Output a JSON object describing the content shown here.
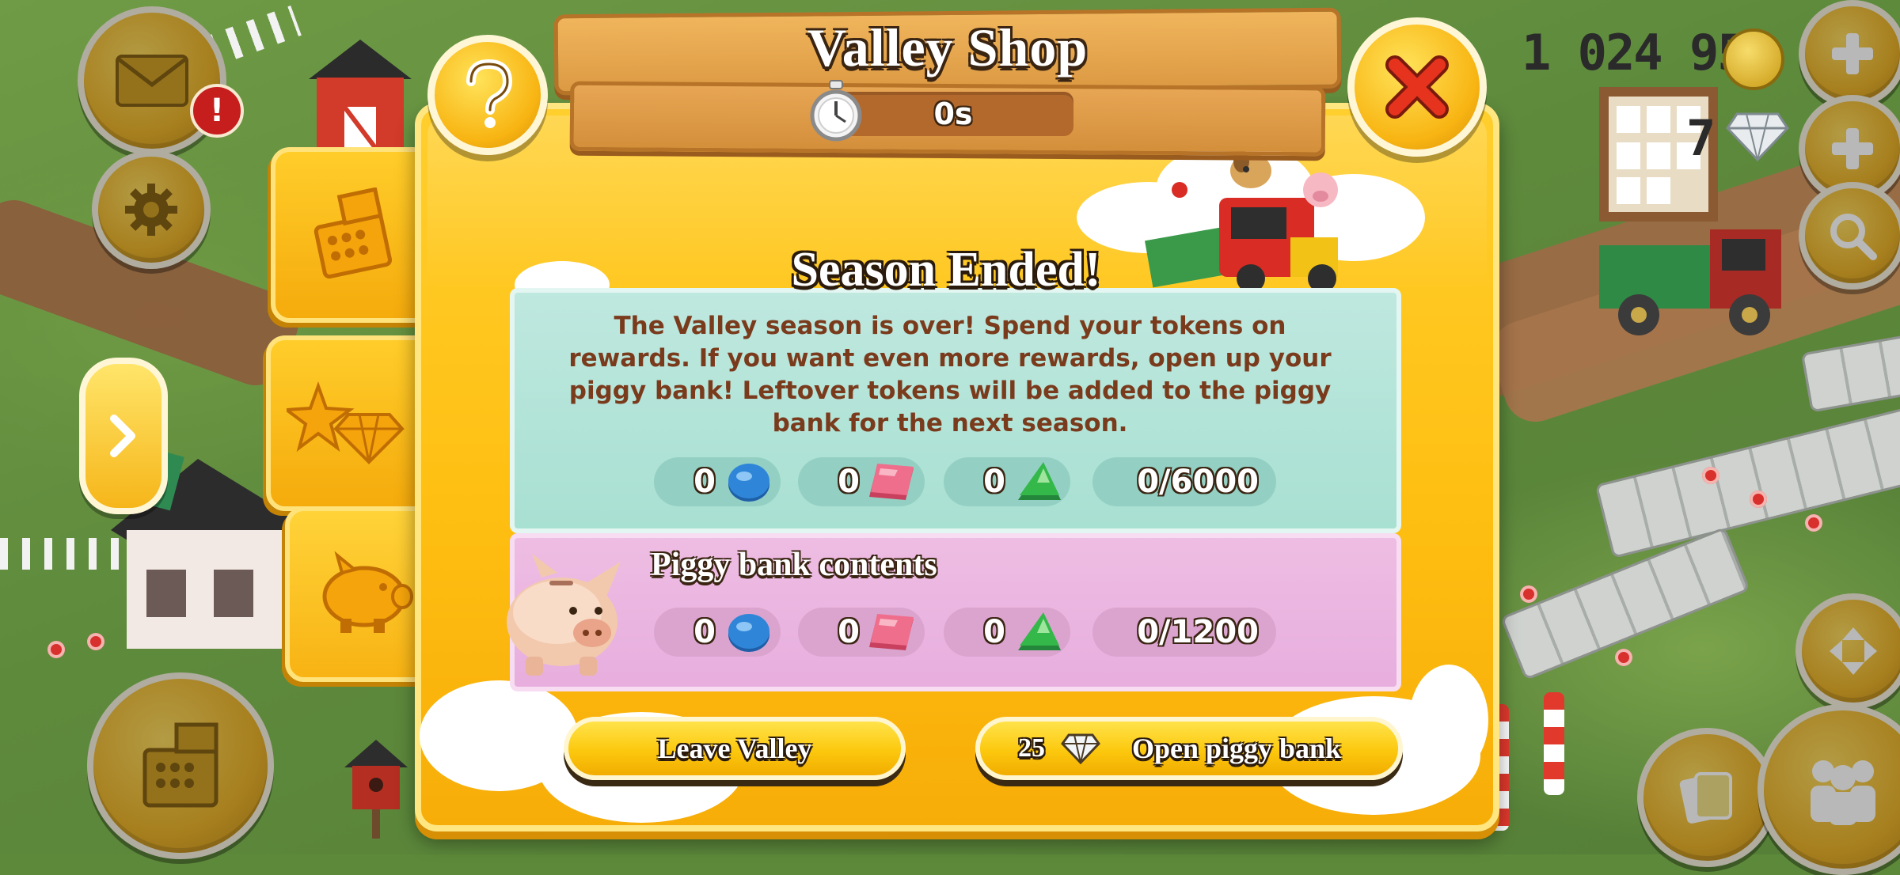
{
  "header": {
    "title": "Valley Shop",
    "timer": "0s"
  },
  "hud": {
    "coins": "1 024 959",
    "diamonds": "7"
  },
  "panel": {
    "heading": "Season Ended!",
    "message": "The Valley season is over! Spend your tokens on rewards. If you want even more rewards, open up your piggy bank! Leftover tokens will be added to the piggy bank for the next season.",
    "tokens": [
      {
        "value": "0",
        "gem": "blue-token-icon"
      },
      {
        "value": "0",
        "gem": "pink-token-icon"
      },
      {
        "value": "0",
        "gem": "green-token-icon"
      }
    ],
    "capacity": "0/6000"
  },
  "piggy": {
    "title": "Piggy bank contents",
    "tokens": [
      {
        "value": "0",
        "gem": "blue-token-icon"
      },
      {
        "value": "0",
        "gem": "pink-token-icon"
      },
      {
        "value": "0",
        "gem": "green-token-icon"
      }
    ],
    "capacity": "0/1200"
  },
  "buttons": {
    "leave": "Leave Valley",
    "open_cost": "25",
    "open": "Open piggy bank"
  },
  "colors": {
    "dialog": "#ffc41a",
    "info_panel": "#a8e0d2",
    "piggy_panel": "#e7aede",
    "token_blue": "#2f86d8",
    "token_pink": "#ef6e8c",
    "token_green": "#35b84a",
    "close_x": "#e6331e"
  }
}
